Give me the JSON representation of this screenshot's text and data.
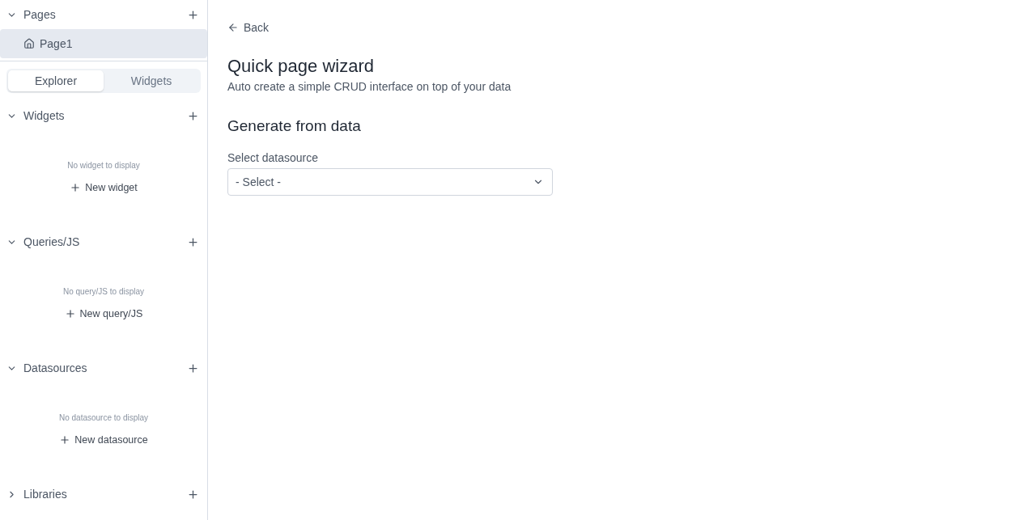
{
  "pages": {
    "title": "Pages",
    "expanded": true,
    "items": [
      {
        "label": "Page1",
        "selected": true
      }
    ]
  },
  "tabs": [
    {
      "label": "Explorer",
      "selected": true
    },
    {
      "label": "Widgets",
      "selected": false
    }
  ],
  "sections": [
    {
      "title": "Widgets",
      "expanded": true,
      "empty_text": "No widget to display",
      "action": "New widget"
    },
    {
      "title": "Queries/JS",
      "expanded": true,
      "empty_text": "No query/JS to display",
      "action": "New query/JS"
    },
    {
      "title": "Datasources",
      "expanded": true,
      "empty_text": "No datasource to display",
      "action": "New datasource"
    },
    {
      "title": "Libraries",
      "expanded": false
    }
  ],
  "main": {
    "back": "Back",
    "title": "Quick page wizard",
    "subtitle": "Auto create a simple CRUD interface on top of your data",
    "section_title": "Generate from data",
    "field": {
      "label": "Select datasource",
      "placeholder": "- Select -"
    }
  }
}
